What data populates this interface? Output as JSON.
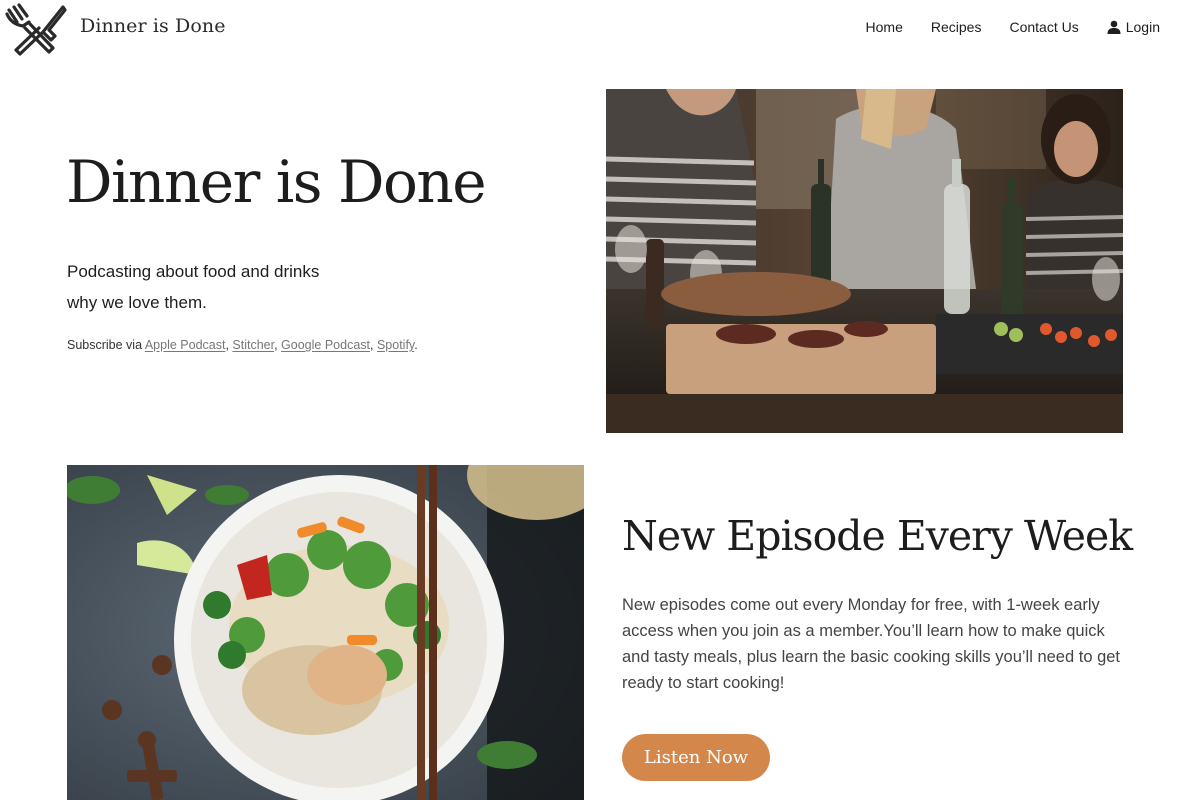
{
  "header": {
    "site_title": "Dinner is Done",
    "logo_icon": "fork-knife-icon",
    "nav": [
      {
        "label": "Home"
      },
      {
        "label": "Recipes"
      },
      {
        "label": "Contact Us"
      },
      {
        "label": "Login",
        "icon": "user-icon"
      }
    ]
  },
  "hero": {
    "title": "Dinner is Done",
    "subtitle_line1": "Podcasting about food and drinks",
    "subtitle_line2": "why we love them.",
    "subscribe_prefix": "Subscribe via",
    "links": [
      "Apple Podcast",
      "Stitcher",
      "Google Podcast",
      "Spotify"
    ],
    "image": "people-cooking-at-kitchen-counter"
  },
  "episode": {
    "image": "noodle-soup-bowl-with-chopsticks",
    "title": "New Episode Every Week",
    "text": "New episodes come out every Monday for free, with 1-week early access when you join as a member.You’ll learn how to make quick and tasty meals, plus learn the basic cooking skills you’ll need to get ready to start cooking!",
    "button_label": "Listen Now"
  },
  "colors": {
    "accent": "#d4874a",
    "text": "#1e1e1e",
    "link": "#777777"
  }
}
